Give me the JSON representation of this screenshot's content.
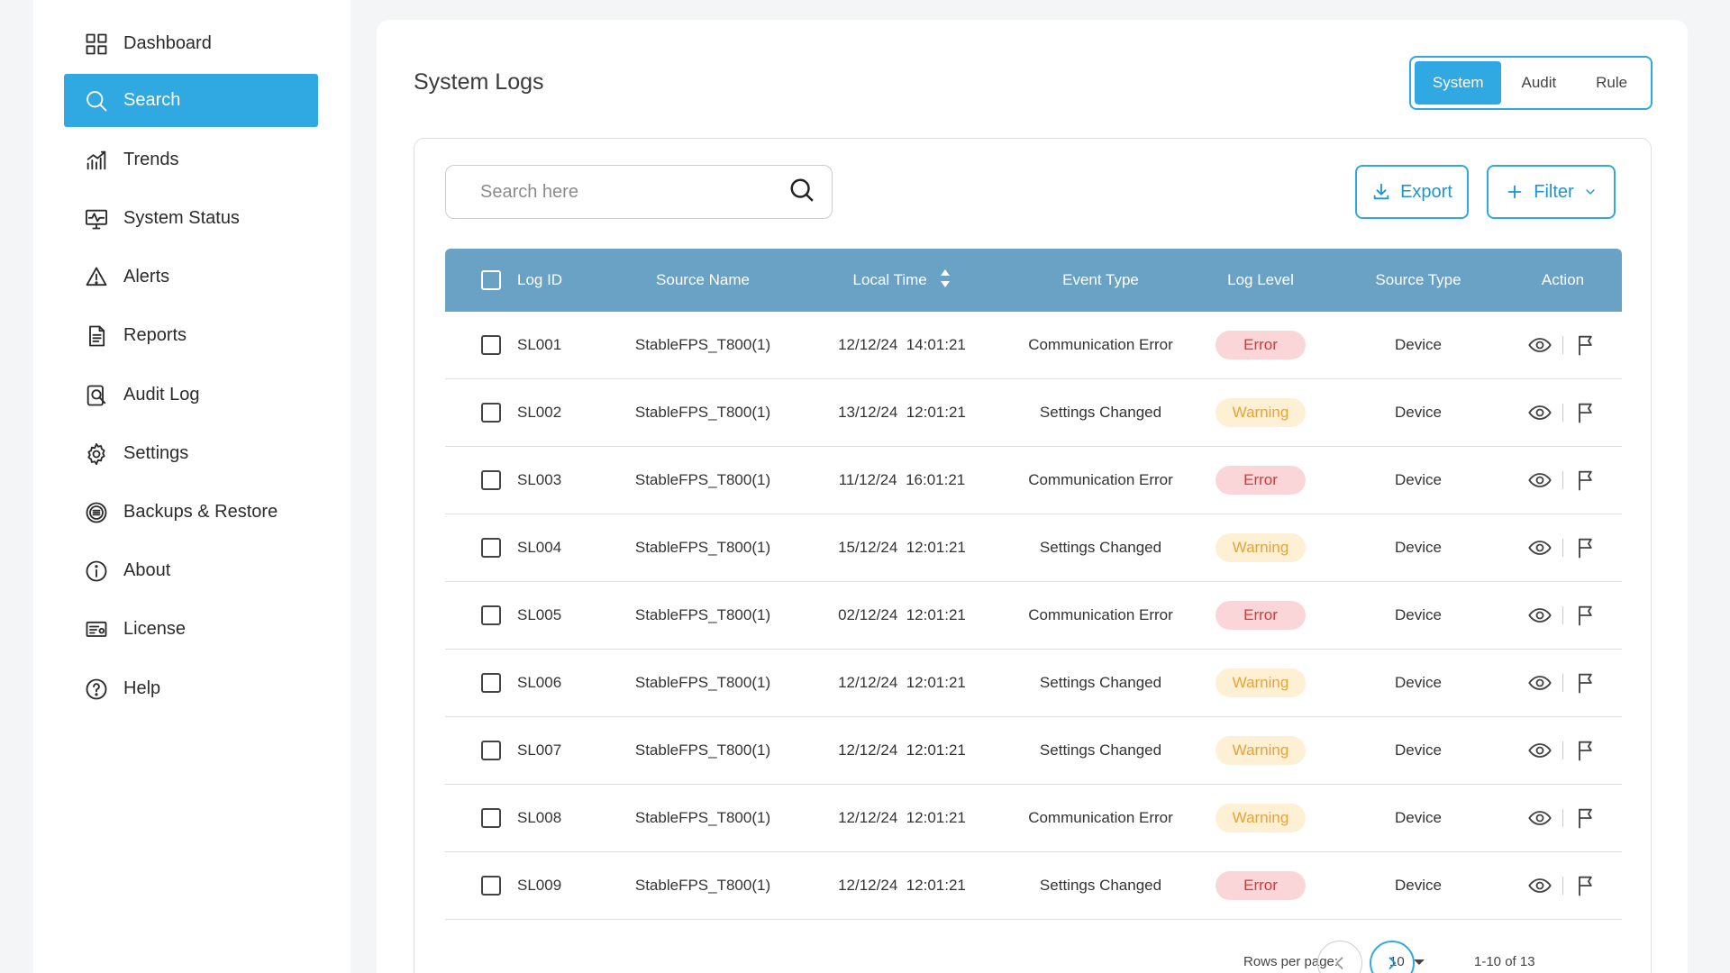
{
  "sidebar": {
    "items": [
      {
        "label": "Dashboard",
        "icon": "grid-icon"
      },
      {
        "label": "Search",
        "icon": "search-icon",
        "active": true
      },
      {
        "label": "Trends",
        "icon": "trend-icon"
      },
      {
        "label": "System Status",
        "icon": "monitor-icon"
      },
      {
        "label": "Alerts",
        "icon": "alert-icon"
      },
      {
        "label": "Reports",
        "icon": "document-icon"
      },
      {
        "label": "Audit Log",
        "icon": "audit-icon"
      },
      {
        "label": "Settings",
        "icon": "gear-icon"
      },
      {
        "label": "Backups & Restore",
        "icon": "backup-icon"
      },
      {
        "label": "About",
        "icon": "info-icon"
      },
      {
        "label": "License",
        "icon": "license-icon"
      },
      {
        "label": "Help",
        "icon": "help-icon"
      }
    ]
  },
  "main": {
    "title": "System Logs",
    "tabs": [
      {
        "label": "System",
        "active": true
      },
      {
        "label": "Audit"
      },
      {
        "label": "Rule"
      }
    ],
    "search": {
      "placeholder": "Search here"
    },
    "export_label": "Export",
    "filter_label": "Filter"
  },
  "table": {
    "headers": {
      "log_id": "Log ID",
      "source_name": "Source Name",
      "local_time": "Local Time",
      "event_type": "Event Type",
      "log_level": "Log Level",
      "source_type": "Source Type",
      "action": "Action"
    },
    "rows": [
      {
        "id": "SL001",
        "source": "StableFPS_T800(1)",
        "time": "12/12/24  14:01:21",
        "event": "Communication Error",
        "level": "Error",
        "stype": "Device"
      },
      {
        "id": "SL002",
        "source": "StableFPS_T800(1)",
        "time": "13/12/24  12:01:21",
        "event": "Settings Changed",
        "level": "Warning",
        "stype": "Device"
      },
      {
        "id": "SL003",
        "source": "StableFPS_T800(1)",
        "time": "11/12/24  16:01:21",
        "event": "Communication Error",
        "level": "Error",
        "stype": "Device"
      },
      {
        "id": "SL004",
        "source": "StableFPS_T800(1)",
        "time": "15/12/24  12:01:21",
        "event": "Settings Changed",
        "level": "Warning",
        "stype": "Device"
      },
      {
        "id": "SL005",
        "source": "StableFPS_T800(1)",
        "time": "02/12/24  12:01:21",
        "event": "Communication Error",
        "level": "Error",
        "stype": "Device"
      },
      {
        "id": "SL006",
        "source": "StableFPS_T800(1)",
        "time": "12/12/24  12:01:21",
        "event": "Settings Changed",
        "level": "Warning",
        "stype": "Device"
      },
      {
        "id": "SL007",
        "source": "StableFPS_T800(1)",
        "time": "12/12/24  12:01:21",
        "event": "Settings Changed",
        "level": "Warning",
        "stype": "Device"
      },
      {
        "id": "SL008",
        "source": "StableFPS_T800(1)",
        "time": "12/12/24  12:01:21",
        "event": "Communication Error",
        "level": "Warning",
        "stype": "Device"
      },
      {
        "id": "SL009",
        "source": "StableFPS_T800(1)",
        "time": "12/12/24  12:01:21",
        "event": "Settings Changed",
        "level": "Error",
        "stype": "Device"
      }
    ]
  },
  "pagination": {
    "rows_per_page_label": "Rows per page:",
    "rows_per_page": "10",
    "range": "1-10 of 13"
  },
  "colors": {
    "accent": "#30a8e2",
    "table_header": "#6aa2c6",
    "error_bg": "#fbd6d8",
    "error_text": "#d23a3a",
    "warning_bg": "#fdf0d5",
    "warning_text": "#e5a33b"
  }
}
